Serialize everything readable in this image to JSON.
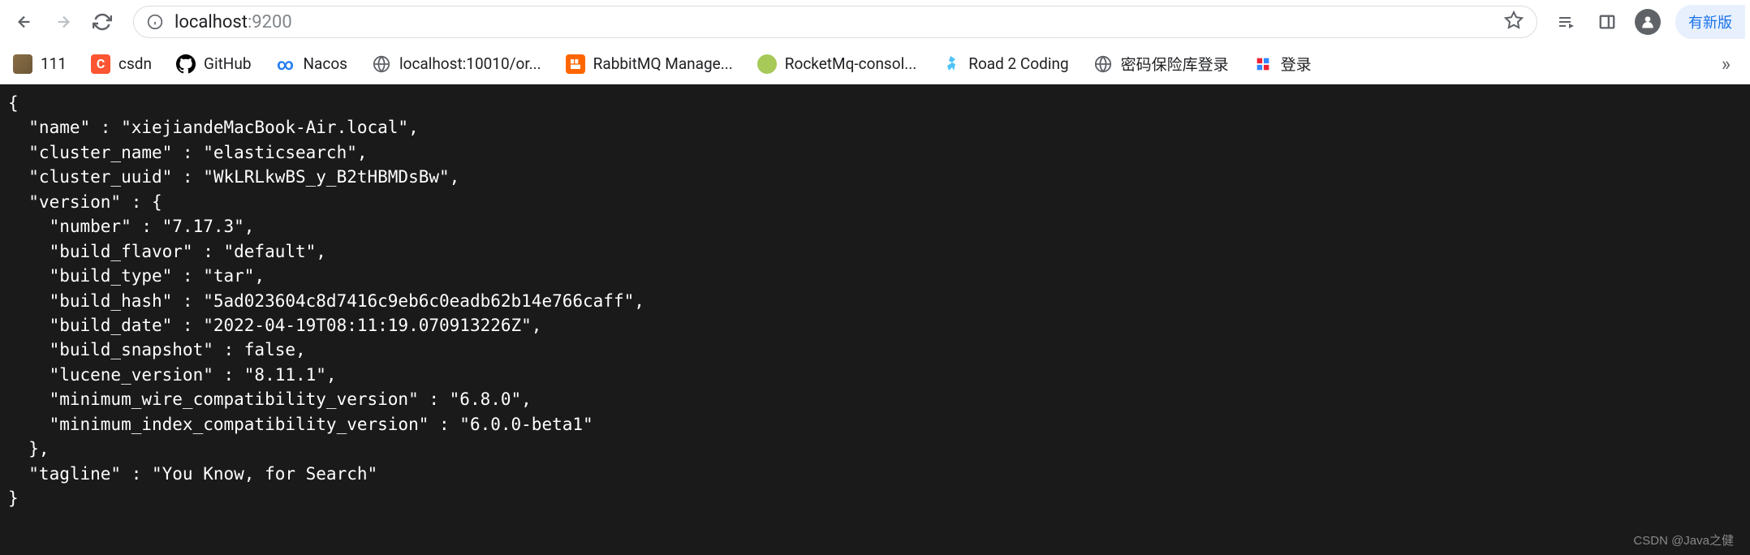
{
  "toolbar": {
    "url_host": "localhost",
    "url_port": ":9200",
    "update_label": "有新版"
  },
  "bookmarks": [
    {
      "label": "111"
    },
    {
      "label": "csdn"
    },
    {
      "label": "GitHub"
    },
    {
      "label": "Nacos"
    },
    {
      "label": "localhost:10010/or..."
    },
    {
      "label": "RabbitMQ Manage..."
    },
    {
      "label": "RocketMq-consol..."
    },
    {
      "label": "Road 2 Coding"
    },
    {
      "label": "密码保险库登录"
    },
    {
      "label": "登录"
    }
  ],
  "response": {
    "name": "xiejiandeMacBook-Air.local",
    "cluster_name": "elasticsearch",
    "cluster_uuid": "WkLRLkwBS_y_B2tHBMDsBw",
    "version": {
      "number": "7.17.3",
      "build_flavor": "default",
      "build_type": "tar",
      "build_hash": "5ad023604c8d7416c9eb6c0eadb62b14e766caff",
      "build_date": "2022-04-19T08:11:19.070913226Z",
      "build_snapshot": false,
      "lucene_version": "8.11.1",
      "minimum_wire_compatibility_version": "6.8.0",
      "minimum_index_compatibility_version": "6.0.0-beta1"
    },
    "tagline": "You Know, for Search"
  },
  "watermark": "CSDN @Java之健"
}
